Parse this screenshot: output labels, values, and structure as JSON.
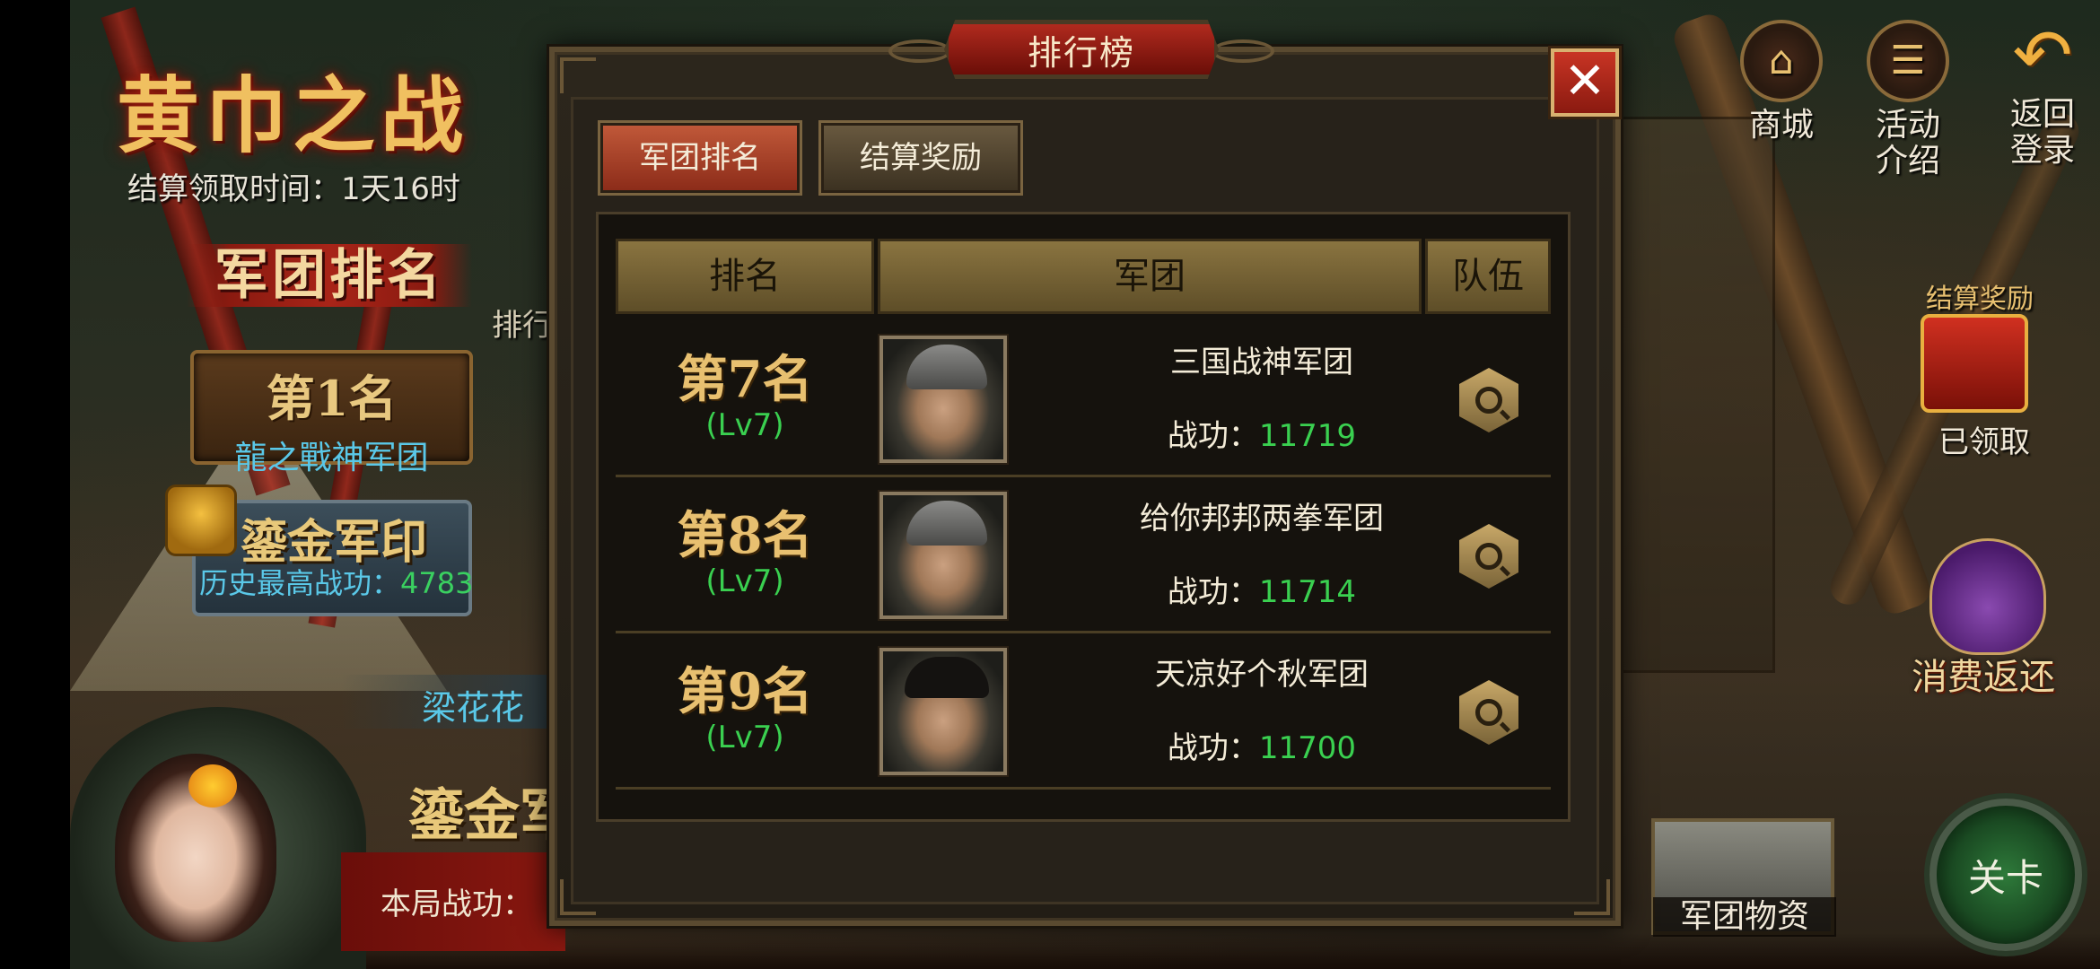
{
  "event": {
    "title": "黄巾之战",
    "settle_time": "结算领取时间：1天16时",
    "ribbon_label": "军团排名",
    "side_rank_label": "排行",
    "top_rank": {
      "rank": "第1名",
      "name": "龍之戰神军团"
    },
    "seal": {
      "title": "鎏金军印",
      "history_label": "历史最高战功：",
      "history_value": "4783"
    },
    "player_name": "梁花花",
    "gild_label": "鎏金军",
    "score_label": "本局战功："
  },
  "right_menu": {
    "shop": "商城",
    "activity": "活动介绍",
    "back": "返回登录",
    "settle_reward_title": "结算奖励",
    "claimed": "已领取",
    "consume_return": "消费返还",
    "stage": "关卡",
    "supply": "军团物资"
  },
  "dialog": {
    "title": "排行榜",
    "close_symbol": "✕",
    "tabs": [
      {
        "label": "军团排名",
        "active": true
      },
      {
        "label": "结算奖励",
        "active": false
      }
    ],
    "columns": [
      "排名",
      "军团",
      "队伍"
    ],
    "score_label": "战功：",
    "rows": [
      {
        "rank": "第7名",
        "level": "(Lv7)",
        "name": "三国战神军团",
        "score": "11719"
      },
      {
        "rank": "第8名",
        "level": "(Lv7)",
        "name": "给你邦邦两拳军团",
        "score": "11714"
      },
      {
        "rank": "第9名",
        "level": "(Lv7)",
        "name": "天凉好个秋军团",
        "score": "11700"
      }
    ]
  },
  "colors": {
    "accent_green": "#3ad050",
    "accent_cyan": "#5ac8e8",
    "gold": "#e8c070",
    "red": "#a82418"
  }
}
